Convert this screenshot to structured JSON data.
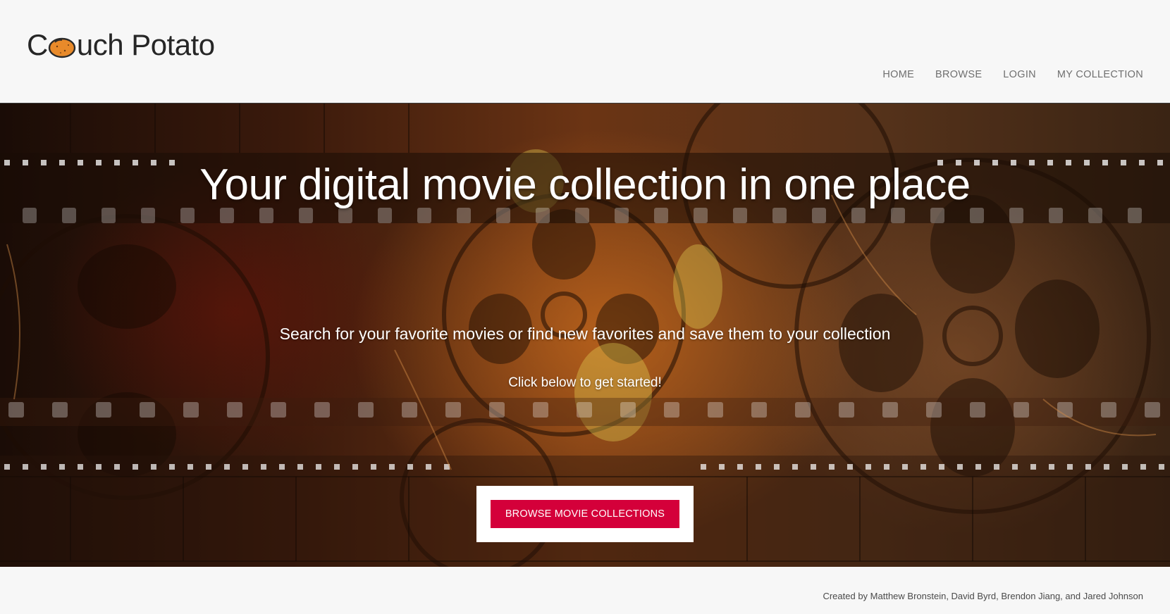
{
  "brand": {
    "name_prefix": "C",
    "name_suffix": "uch Potato",
    "logo_icon": "potato-icon",
    "potato_color": "#e88a2a"
  },
  "nav": {
    "items": [
      {
        "label": "HOME"
      },
      {
        "label": "BROWSE"
      },
      {
        "label": "LOGIN"
      },
      {
        "label": "MY COLLECTION"
      }
    ]
  },
  "hero": {
    "title": "Your digital movie collection in one place",
    "subtitle": "Search for your favorite movies or find new favorites and save them to your collection",
    "cta_text": "Click below to get started!",
    "cta_button_label": "BROWSE MOVIE COLLECTIONS",
    "cta_button_color": "#d4003a",
    "background": "film-reels-and-filmstrip"
  },
  "footer": {
    "credits": "Created by Matthew Bronstein, David Byrd, Brendon Jiang, and Jared Johnson"
  }
}
